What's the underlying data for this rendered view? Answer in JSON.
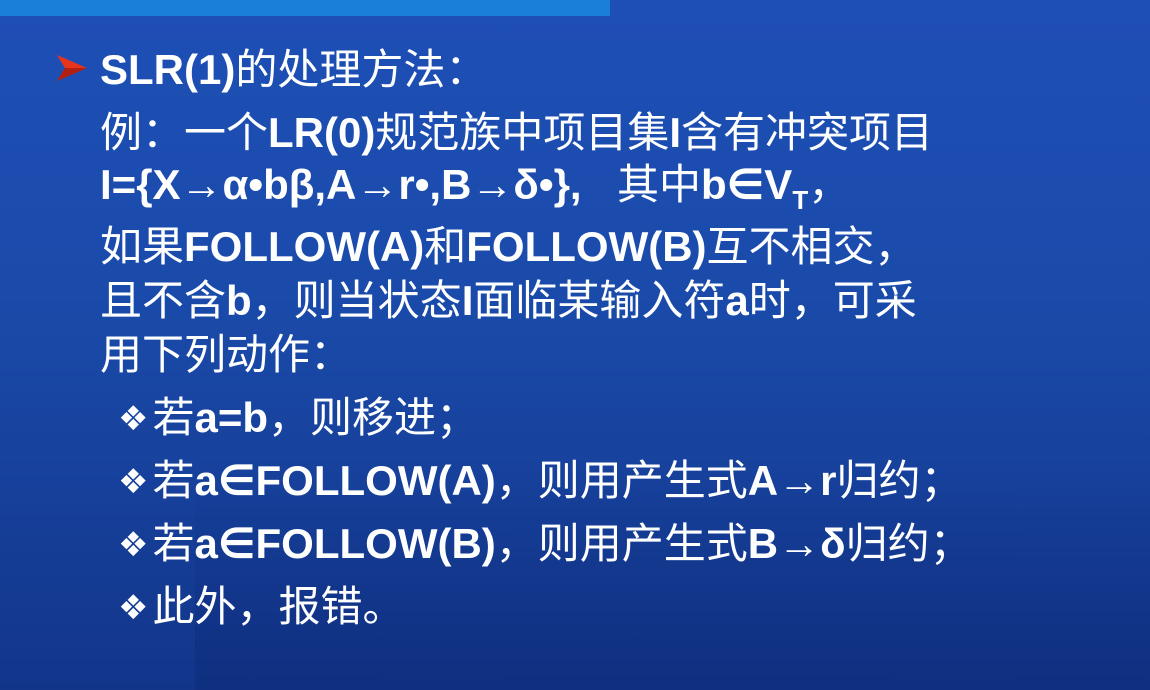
{
  "slide": {
    "heading": {
      "prefix": "SLR(1)",
      "rest": "的处理方法："
    },
    "example": {
      "line1_a": "例：一个",
      "line1_b": "LR(0)",
      "line1_c": "规范族中项目集",
      "line1_d": "I",
      "line1_e": "含有冲突项目",
      "line2_a": "I={X→α•bβ,A→r•,B→δ•},",
      "line2_b": "其中",
      "line2_c": "b∈V",
      "line2_sub": "T",
      "line2_d": "，"
    },
    "condition": {
      "line1_a": "如果",
      "line1_b": "FOLLOW(A)",
      "line1_c": "和",
      "line1_d": "FOLLOW(B)",
      "line1_e": "互不相交，",
      "line2_a": "且不含",
      "line2_b": "b",
      "line2_c": "，则当状态",
      "line2_d": "I",
      "line2_e": "面临某输入符",
      "line2_f": "a",
      "line2_g": "时，可采",
      "line3": "用下列动作："
    },
    "actions": [
      {
        "symbol": "❖",
        "a": "若",
        "b": "a=b",
        "c": "，则移进；"
      },
      {
        "symbol": "❖",
        "a": "若",
        "b": "a∈FOLLOW(A)",
        "c": "，则用产生式",
        "d": "A→r",
        "e": "归约；"
      },
      {
        "symbol": "❖",
        "a": "若",
        "b": "a∈FOLLOW(B)",
        "c": "，则用产生式",
        "d": "B→δ",
        "e": "归约；"
      },
      {
        "symbol": "❖",
        "a": "此外，报错。"
      }
    ],
    "colors": {
      "background": "#1a4aa9",
      "top_bar": "#1a7fd8",
      "bullet_arrow": "#e8341c",
      "text": "#ffffff"
    }
  }
}
